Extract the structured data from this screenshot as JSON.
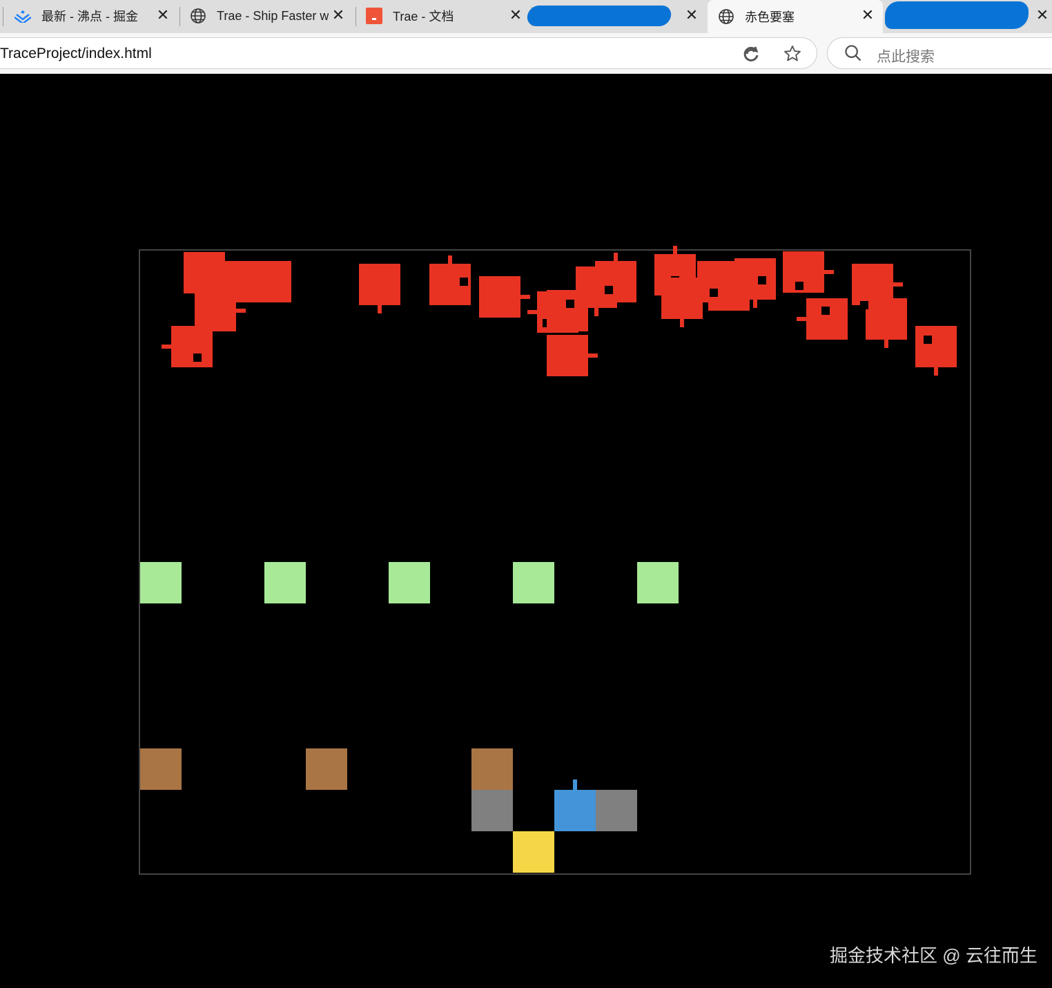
{
  "tabs": [
    {
      "title": "最新 - 沸点 - 掘金",
      "icon": "juejin-logo-icon",
      "active": false
    },
    {
      "title": "Trae - Ship Faster wit",
      "icon": "globe-icon",
      "active": false
    },
    {
      "title": "Trae - 文档",
      "icon": "trae-logo-icon",
      "active": false
    },
    {
      "title": "",
      "icon": "redacted-scribble",
      "active": false
    },
    {
      "title": "赤色要塞",
      "icon": "globe-icon",
      "active": true
    },
    {
      "title": "",
      "icon": "redacted-scribble",
      "active": false
    }
  ],
  "tab_close_glyph": "✕",
  "address": {
    "url": "TraceProject/index.html",
    "search_placeholder": "点此搜索"
  },
  "colors": {
    "enemy_red": "#e83323",
    "bunker_green": "#a7e997",
    "crate_brown": "#a97544",
    "wall_gray": "#808080",
    "player_blue": "#4394d8",
    "base_yellow": "#f5d647",
    "canvas_border": "#444444",
    "redaction_blue": "#0a74d6"
  },
  "game": {
    "enemy_count": 24,
    "bunker_count": 5,
    "crate_count": 3,
    "wall_count": 2,
    "player_tank": "blue",
    "base": "yellow"
  },
  "watermark": "掘金技术社区 @ 云往而生"
}
